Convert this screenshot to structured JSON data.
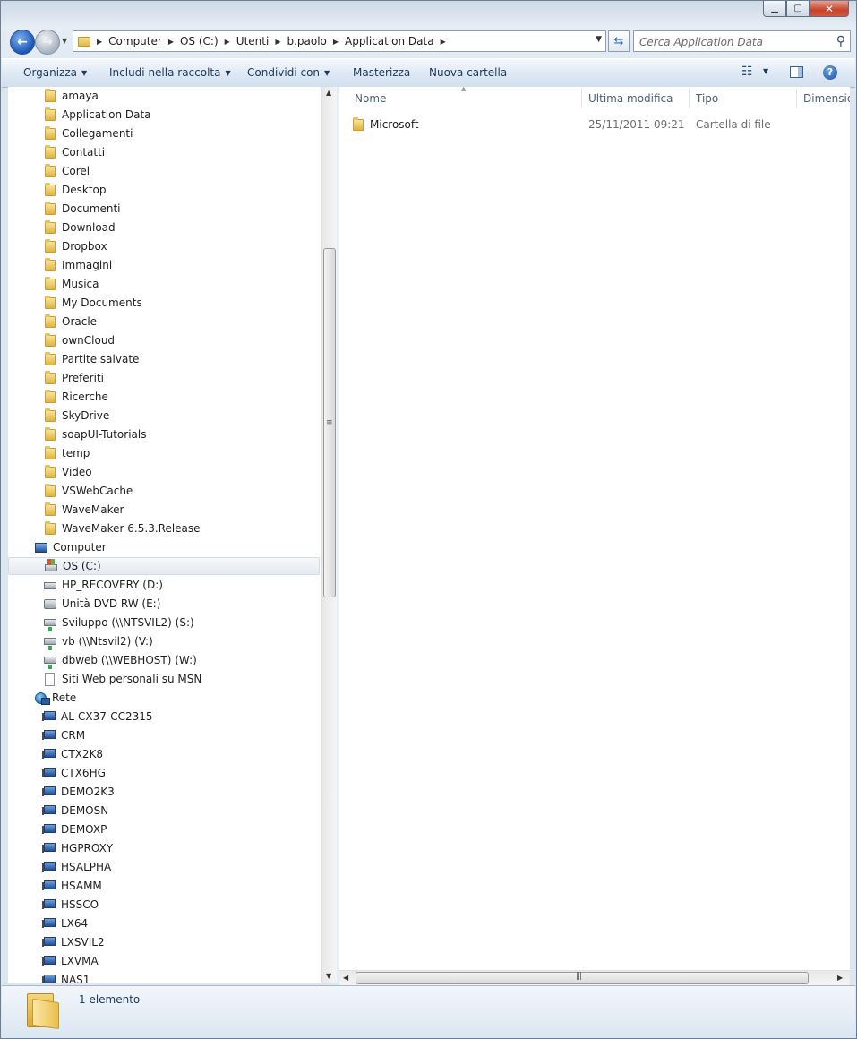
{
  "window": {
    "controls": {
      "minimize": "▁",
      "maximize": "▢",
      "close": "✕"
    }
  },
  "address": {
    "crumbs": [
      "Computer",
      "OS (C:)",
      "Utenti",
      "b.paolo",
      "Application Data"
    ],
    "search_placeholder": "Cerca Application Data"
  },
  "toolbar": {
    "organize": "Organizza",
    "include": "Includi nella raccolta",
    "share": "Condividi con",
    "burn": "Masterizza",
    "new_folder": "Nuova cartella"
  },
  "nav": {
    "folders": [
      {
        "label": "amaya",
        "icon": "folder-icon"
      },
      {
        "label": "Application Data",
        "icon": "folder-icon"
      },
      {
        "label": "Collegamenti",
        "icon": "links-folder-icon"
      },
      {
        "label": "Contatti",
        "icon": "contacts-folder-icon"
      },
      {
        "label": "Corel",
        "icon": "folder-icon"
      },
      {
        "label": "Desktop",
        "icon": "desktop-folder-icon"
      },
      {
        "label": "Documenti",
        "icon": "documents-folder-icon"
      },
      {
        "label": "Download",
        "icon": "downloads-folder-icon"
      },
      {
        "label": "Dropbox",
        "icon": "dropbox-folder-icon"
      },
      {
        "label": "Immagini",
        "icon": "pictures-folder-icon"
      },
      {
        "label": "Musica",
        "icon": "music-folder-icon"
      },
      {
        "label": "My Documents",
        "icon": "folder-icon"
      },
      {
        "label": "Oracle",
        "icon": "folder-icon"
      },
      {
        "label": "ownCloud",
        "icon": "folder-icon"
      },
      {
        "label": "Partite salvate",
        "icon": "saved-games-folder-icon"
      },
      {
        "label": "Preferiti",
        "icon": "favorites-folder-icon"
      },
      {
        "label": "Ricerche",
        "icon": "searches-folder-icon"
      },
      {
        "label": "SkyDrive",
        "icon": "folder-icon"
      },
      {
        "label": "soapUI-Tutorials",
        "icon": "folder-icon"
      },
      {
        "label": "temp",
        "icon": "folder-icon"
      },
      {
        "label": "Video",
        "icon": "videos-folder-icon"
      },
      {
        "label": "VSWebCache",
        "icon": "folder-icon"
      },
      {
        "label": "WaveMaker",
        "icon": "folder-icon"
      },
      {
        "label": "WaveMaker 6.5.3.Release",
        "icon": "folder-icon"
      }
    ],
    "computer_label": "Computer",
    "drives": [
      {
        "label": "OS (C:)",
        "icon": "os-drive-icon",
        "selected": true
      },
      {
        "label": "HP_RECOVERY (D:)",
        "icon": "drive-icon"
      },
      {
        "label": "Unità DVD RW (E:)",
        "icon": "dvd-drive-icon"
      },
      {
        "label": "Sviluppo (\\\\NTSVIL2) (S:)",
        "icon": "network-drive-icon"
      },
      {
        "label": "vb (\\\\Ntsvil2) (V:)",
        "icon": "network-drive-icon"
      },
      {
        "label": "dbweb (\\\\WEBHOST) (W:)",
        "icon": "network-drive-icon"
      },
      {
        "label": "Siti Web personali su MSN",
        "icon": "page-icon"
      }
    ],
    "network_label": "Rete",
    "hosts": [
      "AL-CX37-CC2315",
      "CRM",
      "CTX2K8",
      "CTX6HG",
      "DEMO2K3",
      "DEMOSN",
      "DEMOXP",
      "HGPROXY",
      "HSALPHA",
      "HSAMM",
      "HSSCO",
      "LX64",
      "LXSVIL2",
      "LXVMA",
      "NAS1"
    ]
  },
  "columns": {
    "name": "Nome",
    "modified": "Ultima modifica",
    "type": "Tipo",
    "size": "Dimension"
  },
  "files": [
    {
      "name": "Microsoft",
      "modified": "25/11/2011 09:21",
      "type": "Cartella di file"
    }
  ],
  "status": {
    "count": "1 elemento"
  }
}
